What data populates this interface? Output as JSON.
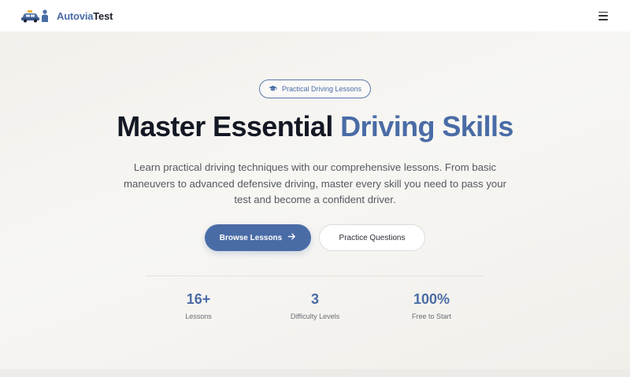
{
  "header": {
    "logo_part1": "Autovia",
    "logo_part2": "Test",
    "menu_icon": "hamburger-menu-icon"
  },
  "hero": {
    "badge_icon": "graduation-cap-icon",
    "badge_label": "Practical Driving Lessons",
    "title_main": "Master Essential ",
    "title_accent": "Driving Skills",
    "subtitle": "Learn practical driving techniques with our comprehensive lessons. From basic maneuvers to advanced defensive driving, master every skill you need to pass your test and become a confident driver.",
    "primary_button": "Browse Lessons",
    "primary_button_icon": "arrow-right-icon",
    "secondary_button": "Practice Questions"
  },
  "stats": [
    {
      "value": "16+",
      "label": "Lessons"
    },
    {
      "value": "3",
      "label": "Difficulty Levels"
    },
    {
      "value": "100%",
      "label": "Free to Start"
    }
  ],
  "colors": {
    "accent": "#4a6ca6",
    "title": "#141824",
    "background": "#f1efeb"
  }
}
